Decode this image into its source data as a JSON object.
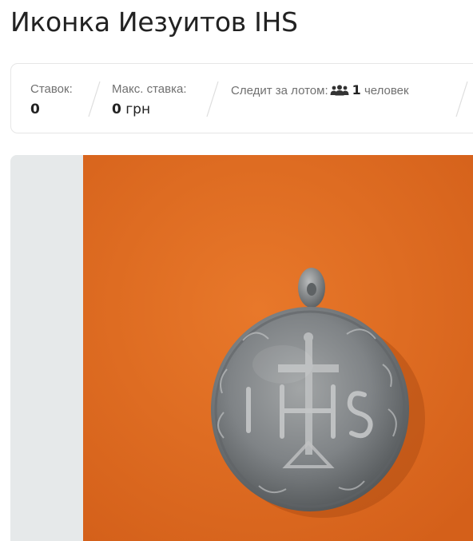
{
  "lot": {
    "title": "Иконка Иезуитов IHS"
  },
  "stats": {
    "bids_label": "Ставок:",
    "bids_value": "0",
    "max_bid_label": "Макс. ставка:",
    "max_bid_amount": "0",
    "max_bid_currency": "грн",
    "watchers_label": "Следит за лотом:",
    "watchers_icon": "people-icon",
    "watchers_count": "1",
    "watchers_unit": "человек"
  },
  "photo": {
    "icon": "coin-pendant-photo",
    "colors": {
      "background": "#e0701f",
      "metal": "#8b8f92"
    }
  }
}
